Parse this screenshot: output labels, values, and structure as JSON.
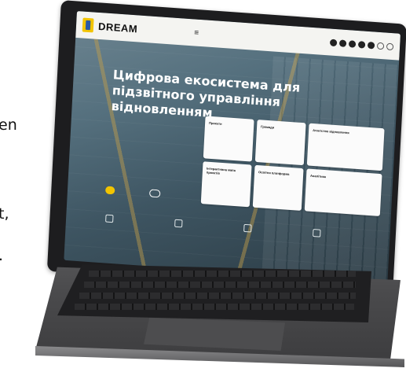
{
  "side_text": {
    "line1": "en",
    "line2": "t,",
    "line3": "."
  },
  "screen": {
    "brand": "DREAM",
    "brand_sub": "",
    "menu_glyph": "≡",
    "top_icons": [
      "icon",
      "icon",
      "icon",
      "icon",
      "icon",
      "icon-outline",
      "icon-outline"
    ],
    "nav": [
      {
        "label": "",
        "active": true
      },
      {
        "label": "",
        "active": false
      },
      {
        "label": "",
        "active": false
      },
      {
        "label": "",
        "active": false
      },
      {
        "label": "",
        "active": false
      },
      {
        "label": "",
        "active": false
      },
      {
        "label": "",
        "active": false
      }
    ],
    "headline": "Цифрова екосистема для підзвітного управління відновленням",
    "intro": "",
    "buttons": {
      "primary": "",
      "secondary": ""
    },
    "cards": [
      {
        "label": "Проєкти"
      },
      {
        "label": "Громади"
      },
      {
        "label": "Агентство відновлення"
      },
      {
        "label": "Інтерактивна мапа проєктів"
      },
      {
        "label": "Освітня платформа"
      },
      {
        "label": "Аналітика"
      }
    ],
    "partners": [
      {
        "label": ""
      },
      {
        "label": ""
      },
      {
        "label": ""
      },
      {
        "label": ""
      }
    ]
  },
  "colors": {
    "accent": "#f2c400",
    "brand_blue": "#2a59a6",
    "laptop_body": "#4a4a4c"
  }
}
